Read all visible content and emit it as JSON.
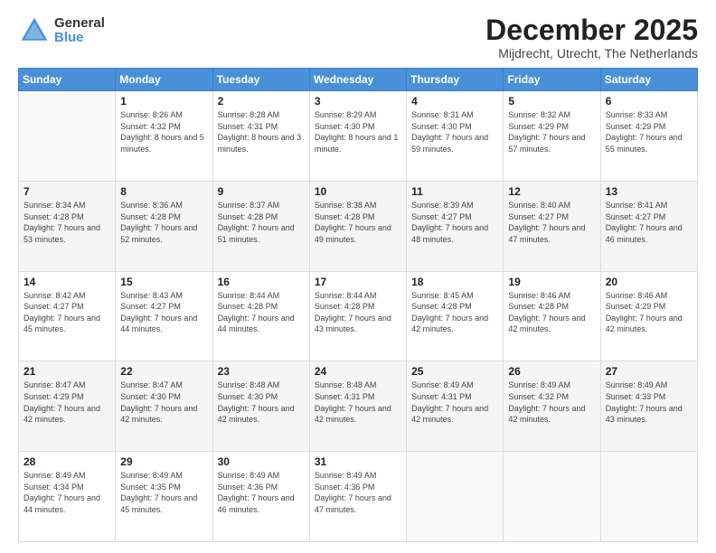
{
  "logo": {
    "general": "General",
    "blue": "Blue"
  },
  "header": {
    "title": "December 2025",
    "location": "Mijdrecht, Utrecht, The Netherlands"
  },
  "weekdays": [
    "Sunday",
    "Monday",
    "Tuesday",
    "Wednesday",
    "Thursday",
    "Friday",
    "Saturday"
  ],
  "weeks": [
    [
      {
        "day": "",
        "sunrise": "",
        "sunset": "",
        "daylight": ""
      },
      {
        "day": "1",
        "sunrise": "Sunrise: 8:26 AM",
        "sunset": "Sunset: 4:32 PM",
        "daylight": "Daylight: 8 hours and 5 minutes."
      },
      {
        "day": "2",
        "sunrise": "Sunrise: 8:28 AM",
        "sunset": "Sunset: 4:31 PM",
        "daylight": "Daylight: 8 hours and 3 minutes."
      },
      {
        "day": "3",
        "sunrise": "Sunrise: 8:29 AM",
        "sunset": "Sunset: 4:30 PM",
        "daylight": "Daylight: 8 hours and 1 minute."
      },
      {
        "day": "4",
        "sunrise": "Sunrise: 8:31 AM",
        "sunset": "Sunset: 4:30 PM",
        "daylight": "Daylight: 7 hours and 59 minutes."
      },
      {
        "day": "5",
        "sunrise": "Sunrise: 8:32 AM",
        "sunset": "Sunset: 4:29 PM",
        "daylight": "Daylight: 7 hours and 57 minutes."
      },
      {
        "day": "6",
        "sunrise": "Sunrise: 8:33 AM",
        "sunset": "Sunset: 4:29 PM",
        "daylight": "Daylight: 7 hours and 55 minutes."
      }
    ],
    [
      {
        "day": "7",
        "sunrise": "Sunrise: 8:34 AM",
        "sunset": "Sunset: 4:28 PM",
        "daylight": "Daylight: 7 hours and 53 minutes."
      },
      {
        "day": "8",
        "sunrise": "Sunrise: 8:36 AM",
        "sunset": "Sunset: 4:28 PM",
        "daylight": "Daylight: 7 hours and 52 minutes."
      },
      {
        "day": "9",
        "sunrise": "Sunrise: 8:37 AM",
        "sunset": "Sunset: 4:28 PM",
        "daylight": "Daylight: 7 hours and 51 minutes."
      },
      {
        "day": "10",
        "sunrise": "Sunrise: 8:38 AM",
        "sunset": "Sunset: 4:28 PM",
        "daylight": "Daylight: 7 hours and 49 minutes."
      },
      {
        "day": "11",
        "sunrise": "Sunrise: 8:39 AM",
        "sunset": "Sunset: 4:27 PM",
        "daylight": "Daylight: 7 hours and 48 minutes."
      },
      {
        "day": "12",
        "sunrise": "Sunrise: 8:40 AM",
        "sunset": "Sunset: 4:27 PM",
        "daylight": "Daylight: 7 hours and 47 minutes."
      },
      {
        "day": "13",
        "sunrise": "Sunrise: 8:41 AM",
        "sunset": "Sunset: 4:27 PM",
        "daylight": "Daylight: 7 hours and 46 minutes."
      }
    ],
    [
      {
        "day": "14",
        "sunrise": "Sunrise: 8:42 AM",
        "sunset": "Sunset: 4:27 PM",
        "daylight": "Daylight: 7 hours and 45 minutes."
      },
      {
        "day": "15",
        "sunrise": "Sunrise: 8:43 AM",
        "sunset": "Sunset: 4:27 PM",
        "daylight": "Daylight: 7 hours and 44 minutes."
      },
      {
        "day": "16",
        "sunrise": "Sunrise: 8:44 AM",
        "sunset": "Sunset: 4:28 PM",
        "daylight": "Daylight: 7 hours and 44 minutes."
      },
      {
        "day": "17",
        "sunrise": "Sunrise: 8:44 AM",
        "sunset": "Sunset: 4:28 PM",
        "daylight": "Daylight: 7 hours and 43 minutes."
      },
      {
        "day": "18",
        "sunrise": "Sunrise: 8:45 AM",
        "sunset": "Sunset: 4:28 PM",
        "daylight": "Daylight: 7 hours and 42 minutes."
      },
      {
        "day": "19",
        "sunrise": "Sunrise: 8:46 AM",
        "sunset": "Sunset: 4:28 PM",
        "daylight": "Daylight: 7 hours and 42 minutes."
      },
      {
        "day": "20",
        "sunrise": "Sunrise: 8:46 AM",
        "sunset": "Sunset: 4:29 PM",
        "daylight": "Daylight: 7 hours and 42 minutes."
      }
    ],
    [
      {
        "day": "21",
        "sunrise": "Sunrise: 8:47 AM",
        "sunset": "Sunset: 4:29 PM",
        "daylight": "Daylight: 7 hours and 42 minutes."
      },
      {
        "day": "22",
        "sunrise": "Sunrise: 8:47 AM",
        "sunset": "Sunset: 4:30 PM",
        "daylight": "Daylight: 7 hours and 42 minutes."
      },
      {
        "day": "23",
        "sunrise": "Sunrise: 8:48 AM",
        "sunset": "Sunset: 4:30 PM",
        "daylight": "Daylight: 7 hours and 42 minutes."
      },
      {
        "day": "24",
        "sunrise": "Sunrise: 8:48 AM",
        "sunset": "Sunset: 4:31 PM",
        "daylight": "Daylight: 7 hours and 42 minutes."
      },
      {
        "day": "25",
        "sunrise": "Sunrise: 8:49 AM",
        "sunset": "Sunset: 4:31 PM",
        "daylight": "Daylight: 7 hours and 42 minutes."
      },
      {
        "day": "26",
        "sunrise": "Sunrise: 8:49 AM",
        "sunset": "Sunset: 4:32 PM",
        "daylight": "Daylight: 7 hours and 42 minutes."
      },
      {
        "day": "27",
        "sunrise": "Sunrise: 8:49 AM",
        "sunset": "Sunset: 4:33 PM",
        "daylight": "Daylight: 7 hours and 43 minutes."
      }
    ],
    [
      {
        "day": "28",
        "sunrise": "Sunrise: 8:49 AM",
        "sunset": "Sunset: 4:34 PM",
        "daylight": "Daylight: 7 hours and 44 minutes."
      },
      {
        "day": "29",
        "sunrise": "Sunrise: 8:49 AM",
        "sunset": "Sunset: 4:35 PM",
        "daylight": "Daylight: 7 hours and 45 minutes."
      },
      {
        "day": "30",
        "sunrise": "Sunrise: 8:49 AM",
        "sunset": "Sunset: 4:36 PM",
        "daylight": "Daylight: 7 hours and 46 minutes."
      },
      {
        "day": "31",
        "sunrise": "Sunrise: 8:49 AM",
        "sunset": "Sunset: 4:36 PM",
        "daylight": "Daylight: 7 hours and 47 minutes."
      },
      {
        "day": "",
        "sunrise": "",
        "sunset": "",
        "daylight": ""
      },
      {
        "day": "",
        "sunrise": "",
        "sunset": "",
        "daylight": ""
      },
      {
        "day": "",
        "sunrise": "",
        "sunset": "",
        "daylight": ""
      }
    ]
  ]
}
